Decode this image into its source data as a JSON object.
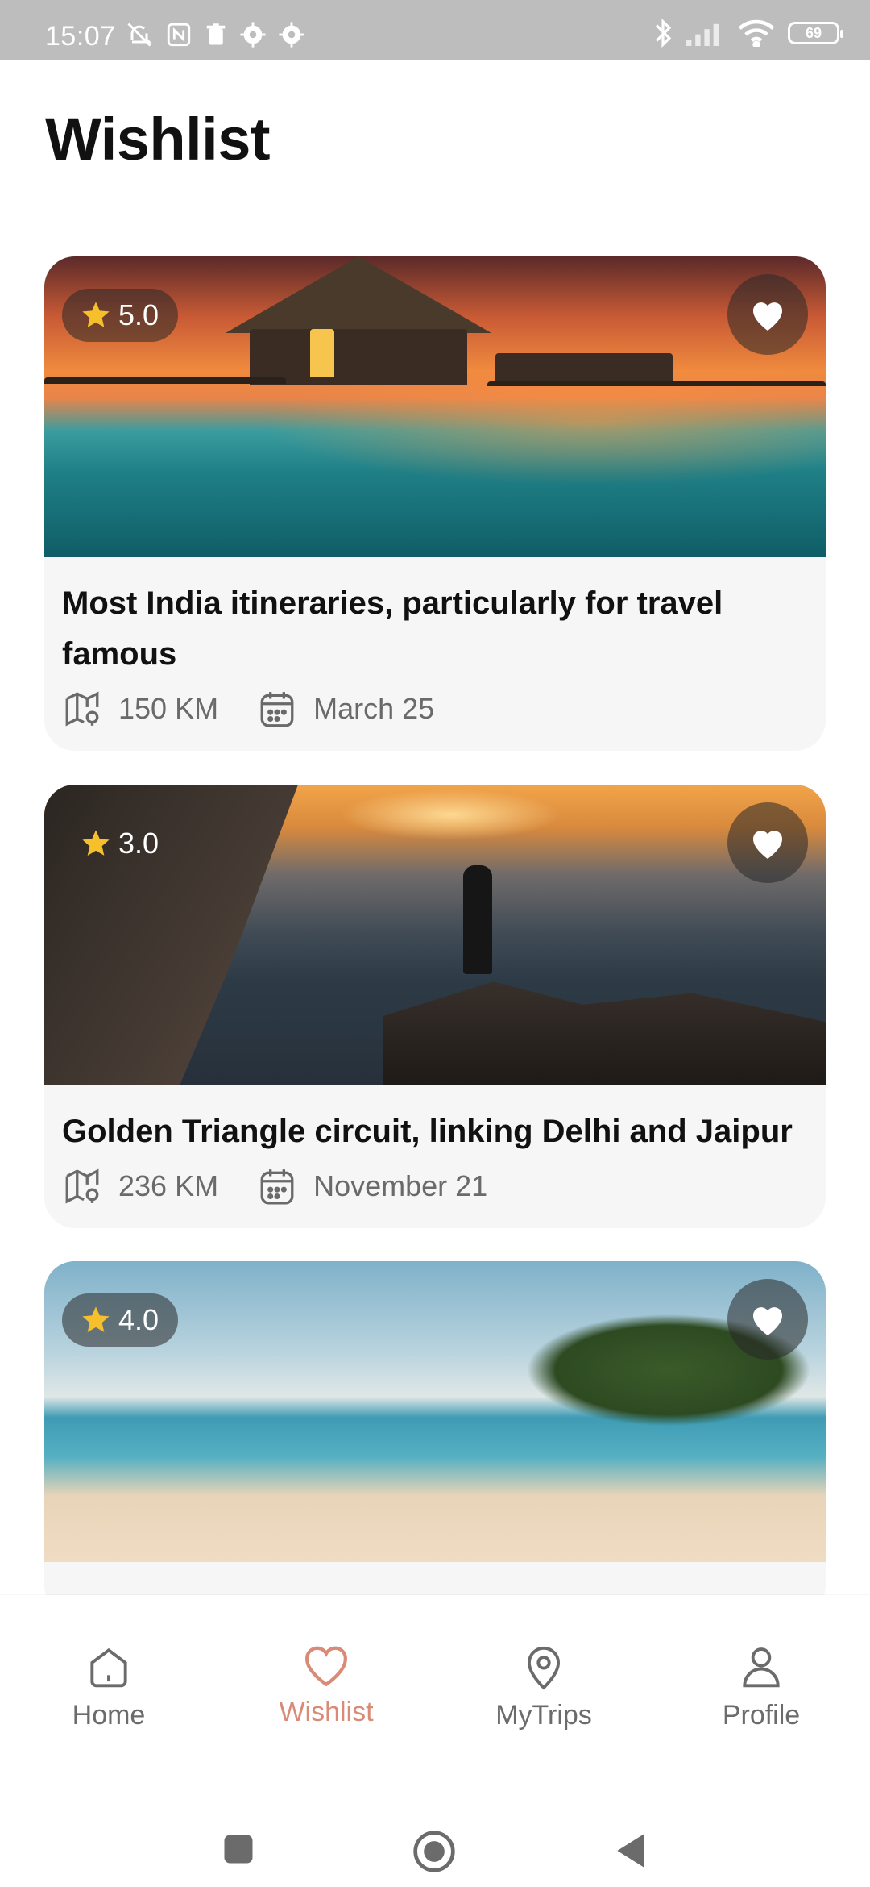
{
  "status_bar": {
    "time": "15:07",
    "battery": "69",
    "left_icons": [
      "mute-icon",
      "nfc-icon",
      "trash-icon",
      "settings-icon",
      "settings-icon"
    ],
    "right_icons": [
      "bluetooth-icon",
      "signal-icon",
      "wifi-icon",
      "battery-icon"
    ]
  },
  "page": {
    "title": "Wishlist"
  },
  "cards": [
    {
      "rating": "5.0",
      "title": "Most India itineraries, particularly for travel famous",
      "distance": "150 KM",
      "date": "March 25",
      "favorited": true
    },
    {
      "rating": "3.0",
      "title": "Golden Triangle circuit, linking Delhi and Jaipur",
      "distance": "236 KM",
      "date": "November 21",
      "favorited": true
    },
    {
      "rating": "4.0",
      "title": "",
      "favorited": true
    }
  ],
  "bottom_nav": {
    "items": [
      {
        "label": "Home",
        "icon": "home-icon"
      },
      {
        "label": "Wishlist",
        "icon": "heart-icon",
        "active": true
      },
      {
        "label": "MyTrips",
        "icon": "location-icon"
      },
      {
        "label": "Profile",
        "icon": "user-icon"
      }
    ]
  },
  "colors": {
    "accent": "#d98b78",
    "star": "#f6c02c",
    "card_bg": "#f6f6f6",
    "text_primary": "#111111",
    "text_secondary": "#6a6a6a"
  }
}
